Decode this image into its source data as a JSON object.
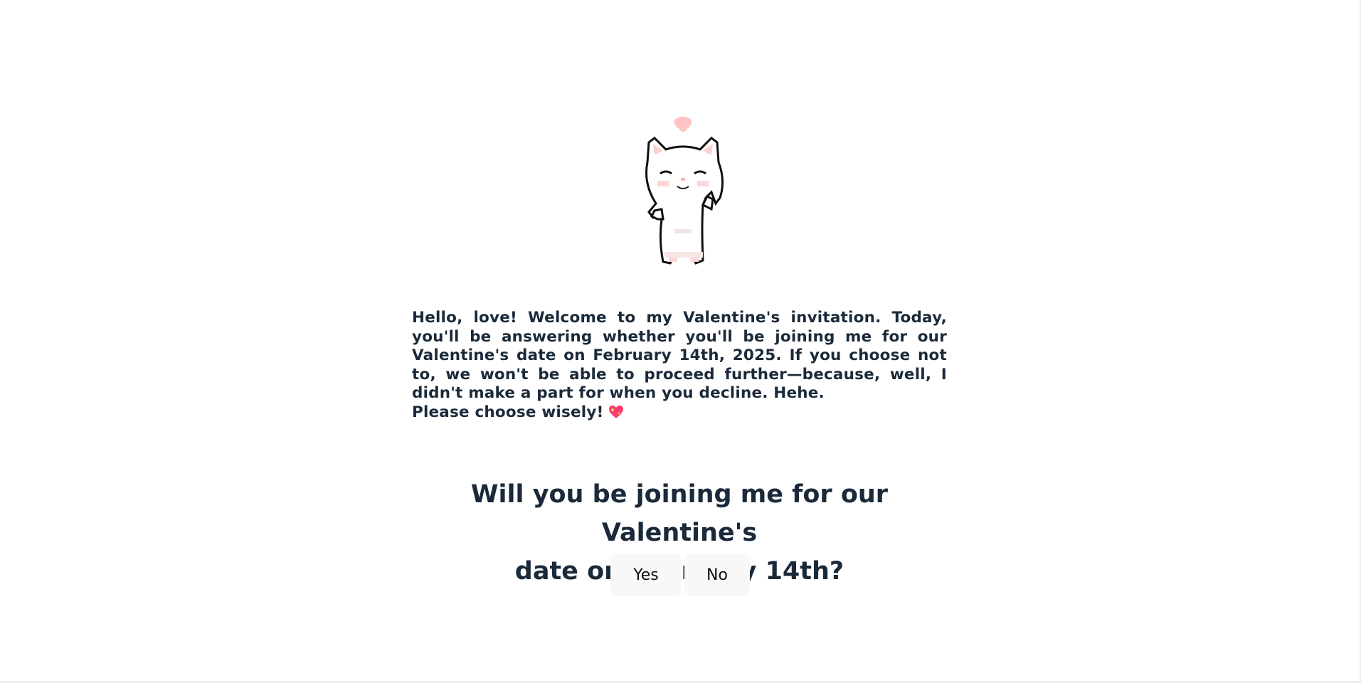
{
  "intro": {
    "paragraph": "Hello, love! Welcome to my Valentine's invitation. Today, you'll be answering whether you'll be joining me for our Valentine's date on February 14th, 2025. If you choose not to, we won't be able to proceed further—because, well, I didn't make a part for when you decline. Hehe.",
    "closing": "Please choose wisely!",
    "closing_icon": "sparkling-heart-icon"
  },
  "question": {
    "line1": "Will you be joining me for our Valentine's",
    "line2": "date on February 14th?"
  },
  "buttons": {
    "yes_label": "Yes",
    "no_label": "No"
  },
  "illustration": {
    "name": "dancing-cat-icon",
    "heart": "heart-icon"
  },
  "colors": {
    "text": "#1b2a3a",
    "button_bg": "#f8f8f8",
    "heart": "#ffc4c4",
    "emoji_heart": "#ff3d6e"
  }
}
